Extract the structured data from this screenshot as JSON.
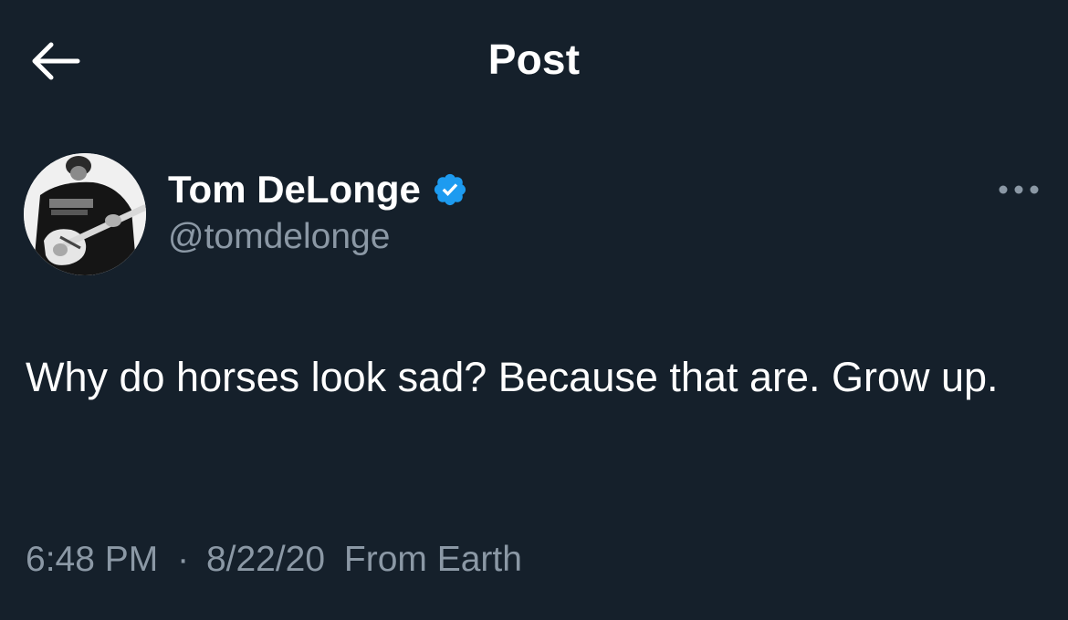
{
  "header": {
    "back_icon": "arrow-left-icon",
    "title": "Post"
  },
  "post": {
    "author": {
      "display_name": "Tom DeLonge",
      "handle": "@tomdelonge",
      "verified": true,
      "verified_color": "#1d9bf0",
      "avatar_icon": "profile-photo-avatar"
    },
    "more_icon": "more-horizontal-icon",
    "text": "Why do horses look sad? Because that are. Grow up.",
    "time": "6:48 PM",
    "separator": "·",
    "date": "8/22/20",
    "source": "From Earth"
  },
  "colors": {
    "background": "#15202b",
    "primary_text": "#ffffff",
    "secondary_text": "#8b98a5"
  }
}
